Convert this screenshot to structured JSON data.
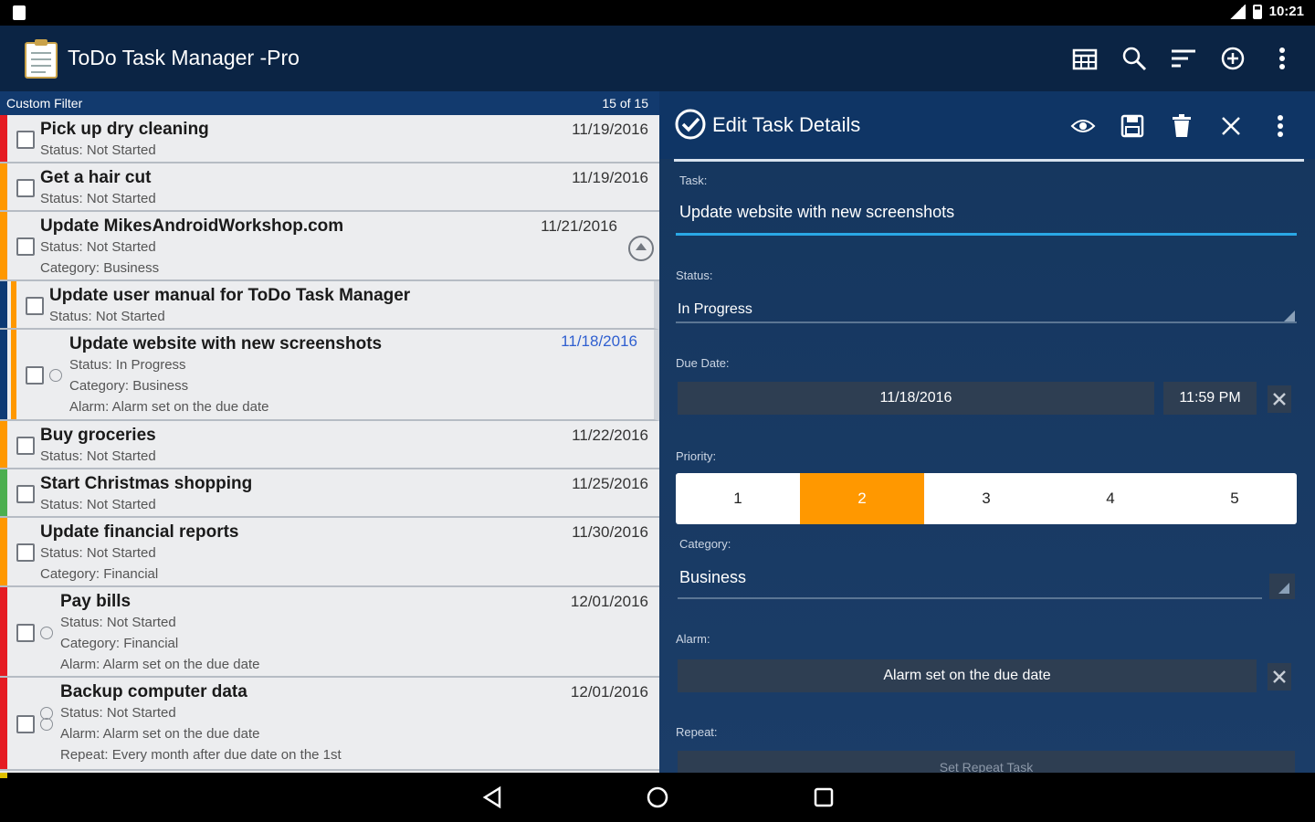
{
  "status_bar": {
    "time": "10:21"
  },
  "app_bar": {
    "title": "ToDo Task Manager -Pro",
    "actions": [
      "calendar-icon",
      "search-icon",
      "sort-icon",
      "add-circle-icon",
      "overflow-menu-icon"
    ]
  },
  "filter_bar": {
    "label": "Custom Filter",
    "count": "15 of 15"
  },
  "tasks": [
    {
      "name": "Pick up dry cleaning",
      "date": "11/19/2016",
      "meta": [
        "Status: Not Started"
      ],
      "color": "#e51c23"
    },
    {
      "name": "Get a hair cut",
      "date": "11/19/2016",
      "meta": [
        "Status: Not Started"
      ],
      "color": "#ff9800"
    },
    {
      "name": "Update MikesAndroidWorkshop.com",
      "date": "11/21/2016",
      "meta": [
        "Status: Not Started",
        "Category: Business"
      ],
      "color": "#ff9800"
    },
    {
      "name": "Update user manual for ToDo Task Manager",
      "date": "",
      "meta": [
        "Status: Not Started"
      ],
      "color": "#ff9800"
    },
    {
      "name": "Update website with new screenshots",
      "date": "11/18/2016",
      "meta": [
        "Status: In Progress",
        "Category: Business",
        "Alarm: Alarm set on the due date"
      ],
      "color": "#ff9800"
    },
    {
      "name": "Buy groceries",
      "date": "11/22/2016",
      "meta": [
        "Status: Not Started"
      ],
      "color": "#ff9800"
    },
    {
      "name": "Start Christmas shopping",
      "date": "11/25/2016",
      "meta": [
        "Status: Not Started"
      ],
      "color": "#4caf50"
    },
    {
      "name": "Update financial reports",
      "date": "11/30/2016",
      "meta": [
        "Status: Not Started",
        "Category: Financial"
      ],
      "color": "#ff9800"
    },
    {
      "name": "Pay bills",
      "date": "12/01/2016",
      "meta": [
        "Status: Not Started",
        "Category: Financial",
        "Alarm: Alarm set on the due date"
      ],
      "color": "#e51c23"
    },
    {
      "name": "Backup computer data",
      "date": "12/01/2016",
      "meta": [
        "Status: Not Started",
        "Alarm: Alarm set on the due date",
        "Repeat: Every month after due date on the 1st"
      ],
      "color": "#e51c23"
    }
  ],
  "edit_panel": {
    "title": "Edit Task Details",
    "actions": [
      "eye-icon",
      "save-icon",
      "delete-icon",
      "close-icon",
      "overflow-menu-icon"
    ],
    "task_label": "Task:",
    "task_value": "Update website with new screenshots",
    "status_label": "Status:",
    "status_value": "In Progress",
    "due_label": "Due Date:",
    "due_date": "11/18/2016",
    "due_time": "11:59 PM",
    "priority_label": "Priority:",
    "priorities": [
      "1",
      "2",
      "3",
      "4",
      "5"
    ],
    "priority_selected": 2,
    "category_label": "Category:",
    "category_value": "Business",
    "alarm_label": "Alarm:",
    "alarm_value": "Alarm set on the due date",
    "repeat_label": "Repeat:",
    "repeat_button": "Set Repeat Task"
  },
  "nav_bar": [
    "back-icon",
    "home-icon",
    "recents-icon"
  ]
}
